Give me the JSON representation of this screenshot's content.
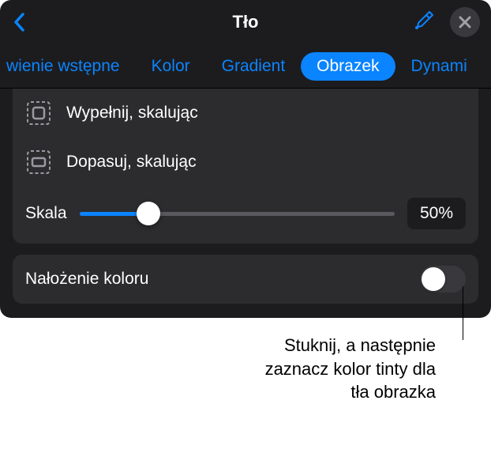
{
  "header": {
    "title": "Tło"
  },
  "tabs": {
    "partial_left": "wienie wstępne",
    "items": [
      "Kolor",
      "Gradient",
      "Obrazek"
    ],
    "active_index": 2,
    "partial_right": "Dynami"
  },
  "options": {
    "fill_scale": "Wypełnij, skalując",
    "fit_scale": "Dopasuj, skalując"
  },
  "scale": {
    "label": "Skala",
    "value": "50%",
    "percent": 50
  },
  "overlay": {
    "label": "Nałożenie koloru",
    "on": false
  },
  "callout": {
    "line1": "Stuknij, a następnie",
    "line2": "zaznacz kolor tinty dla",
    "line3": "tła obrazka"
  }
}
